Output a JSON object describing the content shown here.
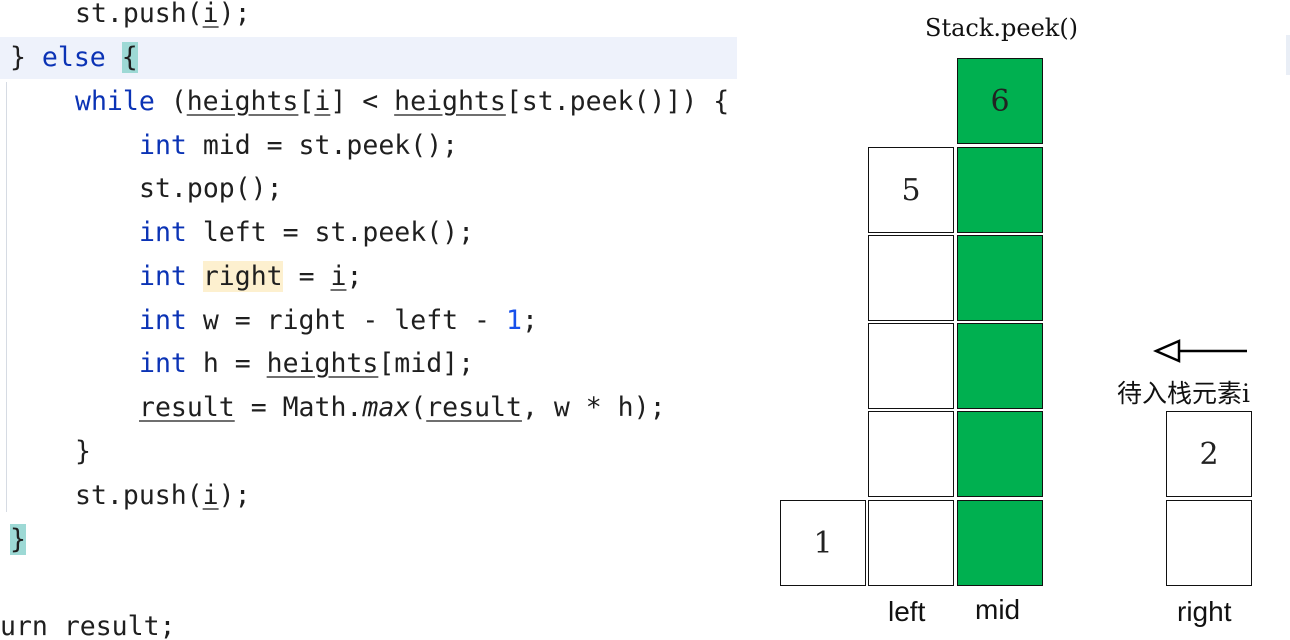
{
  "code": {
    "l1_a": "st.push(",
    "l1_b": "i",
    "l1_c": ");",
    "l2_a": "} ",
    "l2_kw": "else",
    "l2_b": " ",
    "l2_brace": "{",
    "l3_kw": "while",
    "l3_a": " (",
    "l3_h1": "heights",
    "l3_b": "[",
    "l3_i": "i",
    "l3_c": "] < ",
    "l3_h2": "heights",
    "l3_d": "[st.peek()]) {",
    "l4_kw": "int",
    "l4_a": " mid = st.peek();",
    "l5_a": "st.pop();",
    "l6_kw": "int",
    "l6_a": " left = st.peek();",
    "l7_kw": "int",
    "l7_a": " ",
    "l7_var": "right",
    "l7_b": " = ",
    "l7_i": "i",
    "l7_c": ";",
    "l8_kw": "int",
    "l8_a": " w = right - left - ",
    "l8_num": "1",
    "l8_b": ";",
    "l9_kw": "int",
    "l9_a": " h = ",
    "l9_h": "heights",
    "l9_b": "[mid];",
    "l10_r1": "result",
    "l10_a": " = Math.",
    "l10_max": "max",
    "l10_b": "(",
    "l10_r2": "result",
    "l10_c": ", w * h);",
    "l11_a": "}",
    "l12_a": "st.push(",
    "l12_b": "i",
    "l12_c": ");",
    "l13_brace": "}",
    "l14_a": "urn result;"
  },
  "diagram": {
    "peek_label": "Stack.peek()",
    "pending_label": "待入栈元素i",
    "arrow_direction": "left",
    "green_color": "#00b050",
    "cells": {
      "v1": "1",
      "v5": "5",
      "v6": "6",
      "v2": "2"
    },
    "labels": {
      "left": "left",
      "mid": "mid",
      "right": "right"
    }
  }
}
